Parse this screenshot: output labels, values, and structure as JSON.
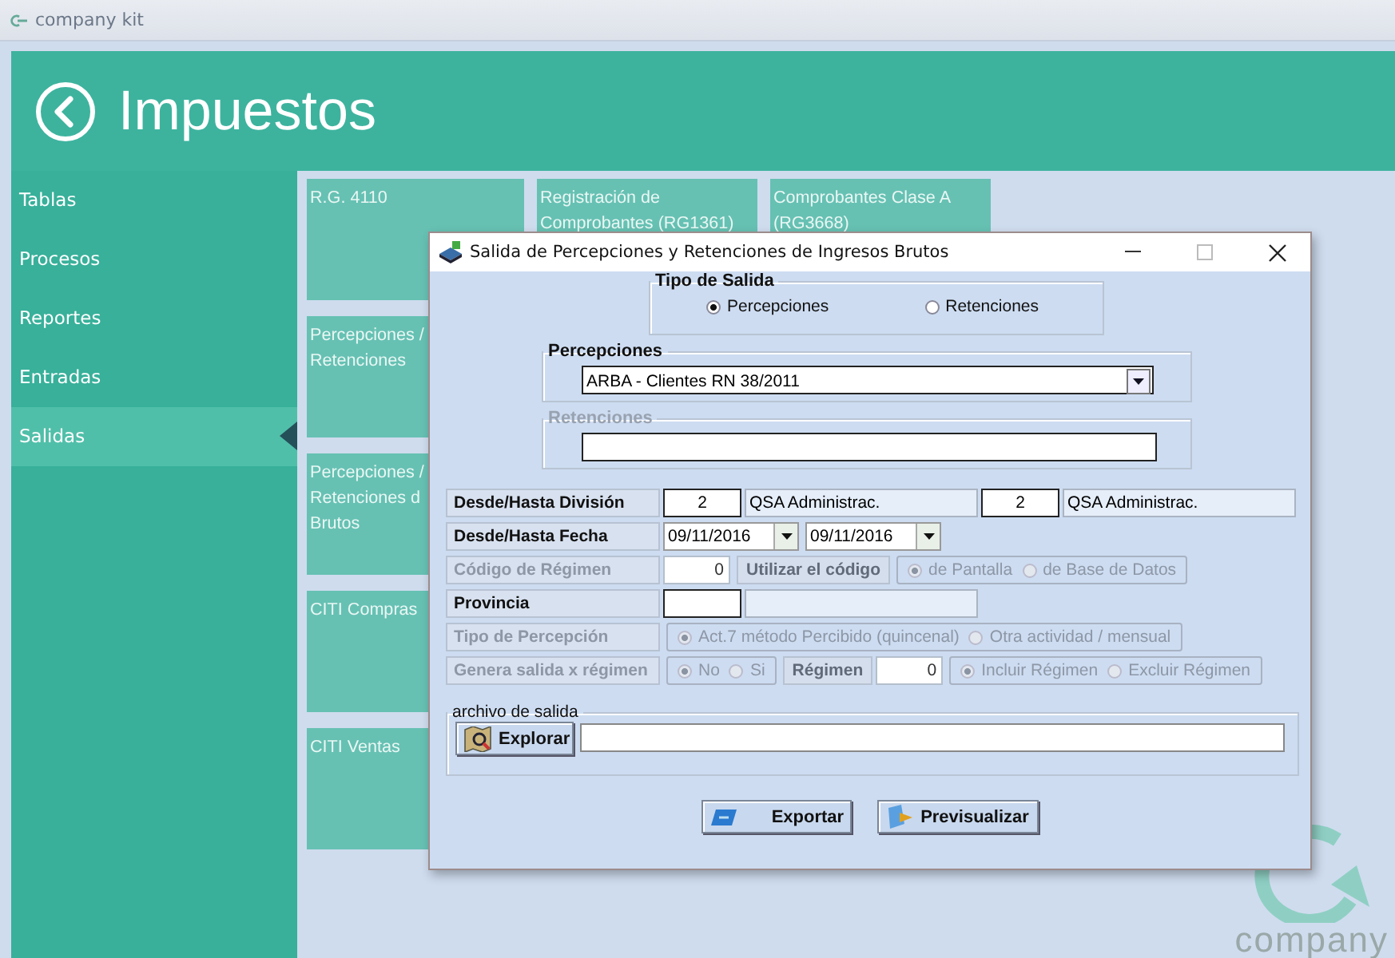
{
  "app": {
    "title": "company kit"
  },
  "header": {
    "title": "Impuestos"
  },
  "sidebar": {
    "items": [
      {
        "label": "Tablas",
        "selected": false
      },
      {
        "label": "Procesos",
        "selected": false
      },
      {
        "label": "Reportes",
        "selected": false
      },
      {
        "label": "Entradas",
        "selected": false
      },
      {
        "label": "Salidas",
        "selected": true
      }
    ]
  },
  "tiles": [
    {
      "lines": [
        "R.G. 4110"
      ]
    },
    {
      "lines": [
        "Registración de",
        "Comprobantes (RG1361)"
      ]
    },
    {
      "lines": [
        "Comprobantes Clase A",
        "(RG3668)"
      ]
    },
    {
      "lines": [
        "Percepciones /",
        "Retenciones"
      ]
    },
    {
      "lines": [
        "Percepciones /",
        "Retenciones d",
        "Brutos"
      ]
    },
    {
      "lines": [
        "CITI Compras"
      ]
    },
    {
      "lines": [
        "CITI Ventas"
      ]
    }
  ],
  "dialog": {
    "title": "Salida de Percepciones y Retenciones de Ingresos Brutos",
    "tipo_de_salida": {
      "legend": "Tipo de Salida",
      "options": [
        {
          "label": "Percepciones",
          "selected": true
        },
        {
          "label": "Retenciones",
          "selected": false
        }
      ]
    },
    "percepciones": {
      "legend": "Percepciones",
      "disabled": false,
      "value": "ARBA - Clientes RN 38/2011"
    },
    "retenciones": {
      "legend": "Retenciones",
      "disabled": true
    },
    "rows": [
      {
        "label": "Desde/Hasta División",
        "disabled": false,
        "controls": [
          {
            "kind": "code",
            "value": "2"
          },
          {
            "kind": "name",
            "value": "QSA Administrac."
          },
          {
            "kind": "code",
            "value": "2"
          },
          {
            "kind": "name",
            "value": "QSA Administrac."
          }
        ]
      },
      {
        "label": "Desde/Hasta Fecha",
        "disabled": false,
        "controls": [
          {
            "kind": "date",
            "value": "09/11/2016"
          },
          {
            "kind": "date",
            "value": "09/11/2016"
          }
        ]
      },
      {
        "label": "Código de Régimen",
        "disabled": true,
        "controls": [
          {
            "kind": "number",
            "value": "0"
          },
          {
            "kind": "tag",
            "label": "Utilizar el código"
          },
          {
            "kind": "radios",
            "options": [
              {
                "label": "de Pantalla",
                "selected": true
              },
              {
                "label": "de Base de Datos",
                "selected": false
              }
            ]
          }
        ]
      },
      {
        "label": "Provincia",
        "disabled": false,
        "controls": [
          {
            "kind": "code"
          },
          {
            "kind": "name"
          }
        ]
      },
      {
        "label": "Tipo de Percepción",
        "disabled": true,
        "controls": [
          {
            "kind": "radios",
            "options": [
              {
                "label": "Act.7 método Percibido (quincenal)",
                "selected": true
              },
              {
                "label": "Otra actividad / mensual",
                "selected": false
              }
            ]
          }
        ]
      },
      {
        "label": "Genera salida x régimen",
        "disabled": true,
        "controls": [
          {
            "kind": "radios",
            "options": [
              {
                "label": "No",
                "selected": true
              },
              {
                "label": "Si",
                "selected": false
              }
            ]
          },
          {
            "kind": "tag",
            "label": "Régimen"
          },
          {
            "kind": "number",
            "value": "0"
          },
          {
            "kind": "radios",
            "options": [
              {
                "label": "Incluir Régimen",
                "selected": true
              },
              {
                "label": "Excluir Régimen",
                "selected": false
              }
            ]
          }
        ]
      }
    ],
    "archivo": {
      "legend": "archivo de salida",
      "button": "Explorar"
    },
    "buttons": [
      {
        "label": "Exportar",
        "kind": "export"
      },
      {
        "label": "Previsualizar",
        "kind": "preview"
      }
    ]
  },
  "brand": {
    "text": "company"
  }
}
